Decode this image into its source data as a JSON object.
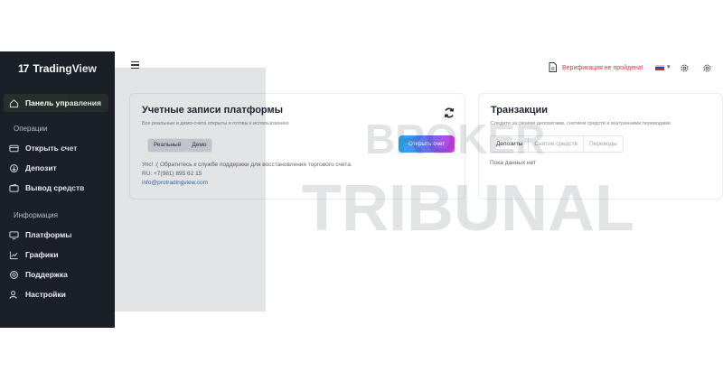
{
  "brand": {
    "name": "TradingView",
    "mark": "17"
  },
  "sidebar": {
    "dashboard": "Панель управления",
    "section_operations": "Операции",
    "operations": [
      "Открыть счет",
      "Депозит",
      "Вывод средств"
    ],
    "section_info": "Информация",
    "info": [
      "Платформы",
      "Графики",
      "Поддержка",
      "Настройки"
    ]
  },
  "topbar": {
    "verification": "Верификация не пройдена!",
    "flag_colors": [
      "#ffffff",
      "#1c4fb8",
      "#d52b1e"
    ]
  },
  "accounts": {
    "title": "Учетные записи платформы",
    "subtitle": "Все реальные и демо-счета открыты и готовы к использованию",
    "toggle": [
      "Реальный",
      "Демо"
    ],
    "open_button": "Открыть счет",
    "note": "Упс! :( Обратитесь к службе поддержки для восстановления торгового счета.",
    "phone": "RU: +7(981) 895 62 15",
    "email": "info@protradingview.com"
  },
  "transactions": {
    "title": "Транзакции",
    "subtitle": "Следите за своими депозитами, снятием средств и внутренними переводами",
    "tabs": [
      "Депозиты",
      "Снятие средств",
      "Переводы"
    ],
    "empty": "Пока данных нет"
  },
  "watermark": {
    "line1": "BROKER",
    "line2": "TRIBUNAL"
  },
  "colors": {
    "sidebar_bg": "#1a1f28",
    "active_bg": "#25302b",
    "warning": "#d13a3a",
    "link": "#3d6fb0"
  }
}
